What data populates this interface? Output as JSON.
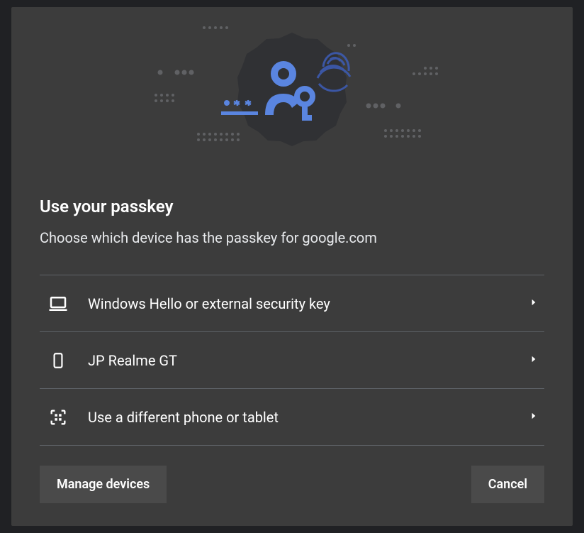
{
  "dialog": {
    "title": "Use your passkey",
    "subtitle": "Choose which device has the passkey for google.com"
  },
  "options": [
    {
      "icon": "laptop",
      "label": "Windows Hello or external security key"
    },
    {
      "icon": "phone",
      "label": "JP Realme GT"
    },
    {
      "icon": "qr",
      "label": "Use a different phone or tablet"
    }
  ],
  "footer": {
    "manage": "Manage devices",
    "cancel": "Cancel"
  },
  "colors": {
    "accent": "#5a85e0",
    "badge": "#303134"
  }
}
